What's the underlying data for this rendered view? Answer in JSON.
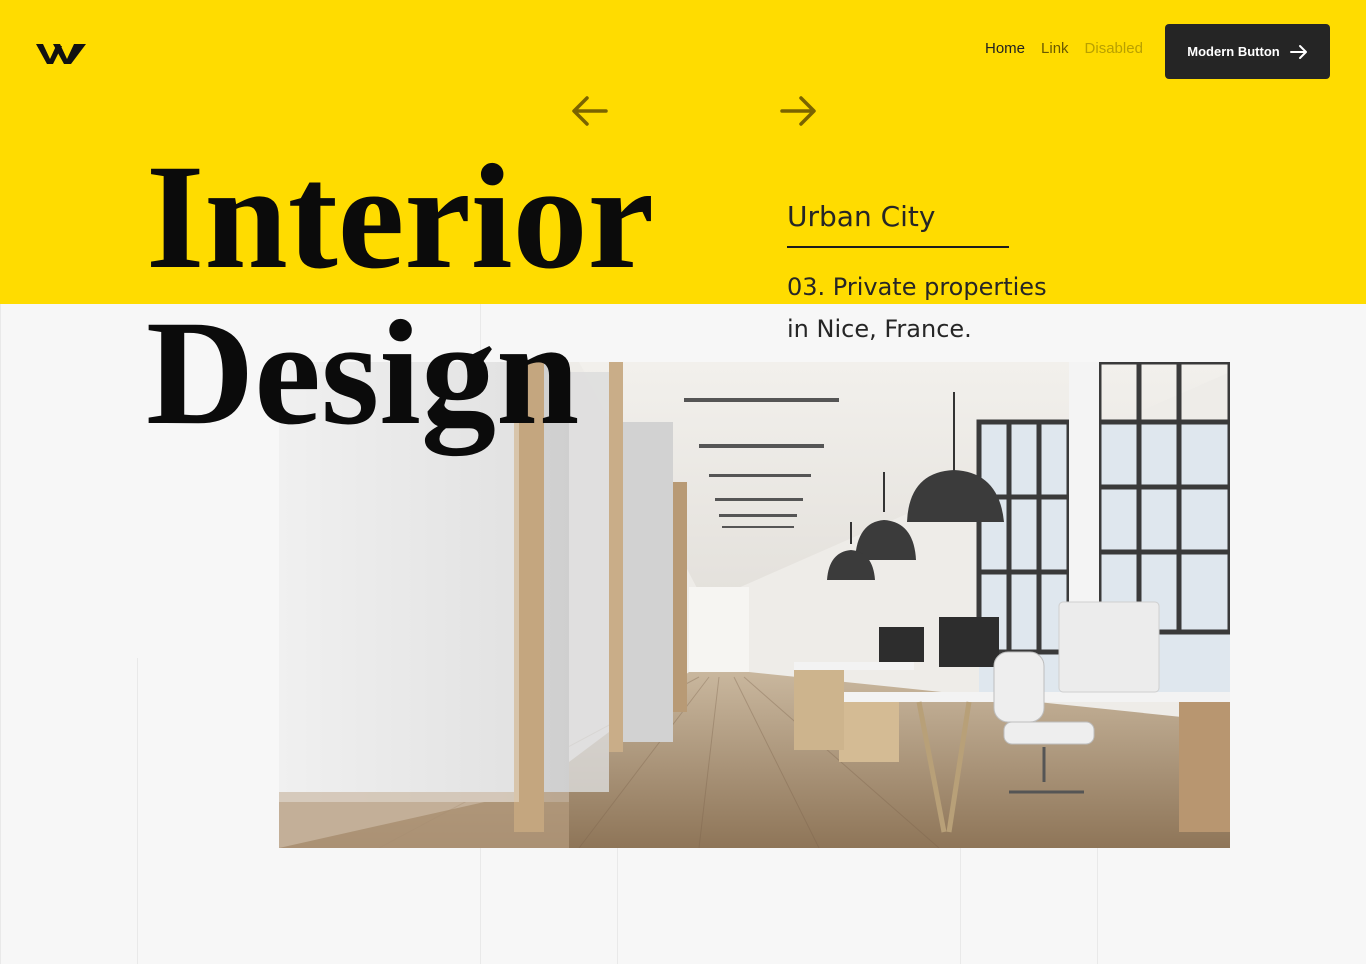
{
  "brand": {
    "logo_icon": "w-logo-icon",
    "accent_color": "#ffdc00"
  },
  "nav": {
    "items": [
      {
        "label": "Home",
        "state": "active"
      },
      {
        "label": "Link",
        "state": "normal"
      },
      {
        "label": "Disabled",
        "state": "disabled"
      }
    ],
    "cta": {
      "label": "Modern Button",
      "icon": "arrow-right-icon"
    }
  },
  "slider": {
    "prev_icon": "arrow-left-icon",
    "next_icon": "arrow-right-icon"
  },
  "hero": {
    "title_line_1": "Interior",
    "title_line_2": "Design",
    "subtitle": "Urban City",
    "description_line_1": "03. Private properties",
    "description_line_2": "in Nice, France.",
    "image": "office-interior-photo"
  }
}
